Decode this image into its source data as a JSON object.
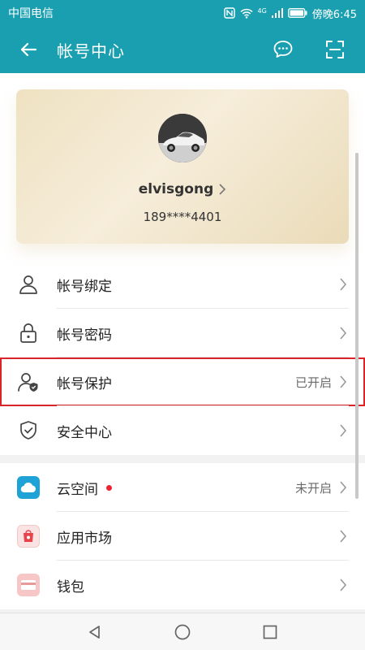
{
  "statusbar": {
    "carrier": "中国电信",
    "time": "傍晚6:45",
    "network": "4G"
  },
  "appbar": {
    "title": "帐号中心"
  },
  "profile": {
    "username": "elvisgong",
    "phone": "189****4401"
  },
  "account_items": [
    {
      "label": "帐号绑定",
      "icon": "user-icon",
      "status": ""
    },
    {
      "label": "帐号密码",
      "icon": "lock-icon",
      "status": ""
    },
    {
      "label": "帐号保护",
      "icon": "user-shield-icon",
      "status": "已开启"
    },
    {
      "label": "安全中心",
      "icon": "shield-check-icon",
      "status": ""
    }
  ],
  "service_items": [
    {
      "label": "云空间",
      "icon": "cloud-icon",
      "status": "未开启",
      "badge": "red-dot"
    },
    {
      "label": "应用市场",
      "icon": "appgallery-icon",
      "status": ""
    },
    {
      "label": "钱包",
      "icon": "wallet-icon",
      "status": ""
    }
  ],
  "colors": {
    "header": "#1a9fb0",
    "highlight": "#d9252a",
    "badge": "#e22233"
  }
}
